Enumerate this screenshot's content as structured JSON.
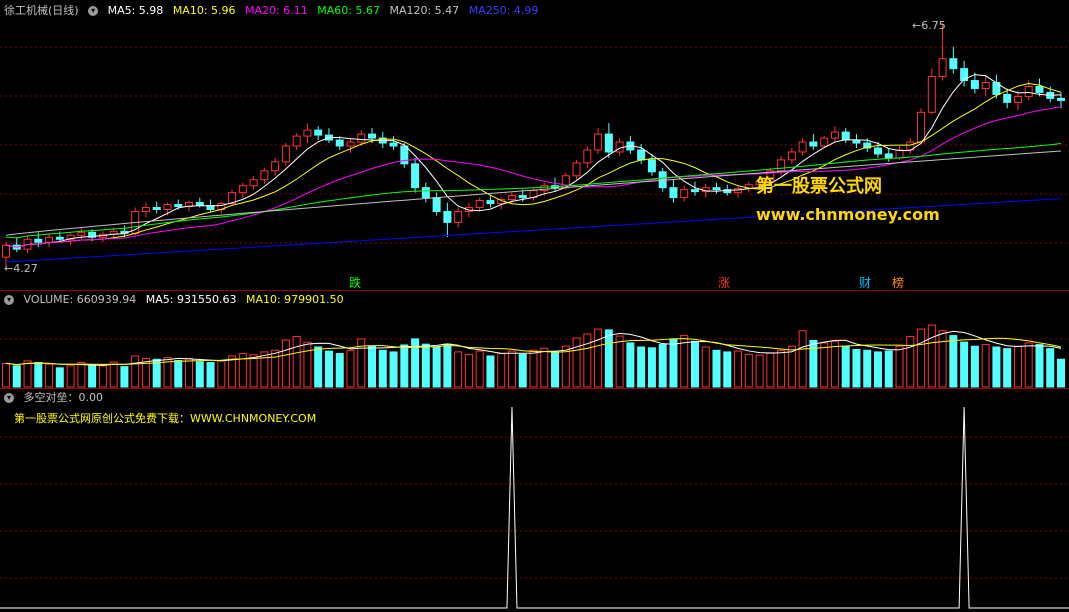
{
  "price_header": {
    "title": "徐工机械(日线)",
    "ma5": "MA5: 5.98",
    "ma10": "MA10: 5.96",
    "ma20": "MA20: 6.11",
    "ma60": "MA60: 5.67",
    "ma120": "MA120: 5.47",
    "ma250": "MA250: 4.99"
  },
  "price_marks": {
    "high": "6.75",
    "low": "4.27"
  },
  "event_tags": [
    {
      "text": "跌",
      "color": "#00ff00"
    },
    {
      "text": "涨",
      "color": "#ff3030"
    },
    {
      "text": "财",
      "color": "#00bfff"
    },
    {
      "text": "榜",
      "color": "#ff8c00"
    }
  ],
  "watermark": {
    "line1": "第一股票公式网",
    "line2": "www.chnmoney.com"
  },
  "volume_header": {
    "volume": "VOLUME: 660939.94",
    "ma5": "MA5: 931550.63",
    "ma10": "MA10: 979901.50"
  },
  "indicator_header": {
    "name": "多空对垒：0.00",
    "note": "第一股票公式网原创公式免费下载：WWW.CHNMONEY.COM"
  },
  "colors": {
    "up": "#ff3030",
    "down": "#54ffff",
    "ma5": "#ffffff",
    "ma10": "#ffff00",
    "ma20": "#ff00ff",
    "ma60": "#00ff00",
    "ma120": "#c0c0c0",
    "ma250": "#0000ff",
    "grid": "#8b0000"
  },
  "chart_data": {
    "type": "candlestick",
    "ylim": [
      4.27,
      6.75
    ],
    "candles": [
      [
        4.4,
        4.55,
        4.3,
        4.52
      ],
      [
        4.52,
        4.6,
        4.45,
        4.48
      ],
      [
        4.48,
        4.62,
        4.44,
        4.58
      ],
      [
        4.58,
        4.65,
        4.5,
        4.55
      ],
      [
        4.55,
        4.63,
        4.5,
        4.6
      ],
      [
        4.6,
        4.66,
        4.55,
        4.58
      ],
      [
        4.58,
        4.64,
        4.52,
        4.62
      ],
      [
        4.62,
        4.7,
        4.58,
        4.65
      ],
      [
        4.65,
        4.68,
        4.56,
        4.6
      ],
      [
        4.6,
        4.66,
        4.55,
        4.63
      ],
      [
        4.63,
        4.7,
        4.58,
        4.66
      ],
      [
        4.66,
        4.72,
        4.6,
        4.64
      ],
      [
        4.64,
        4.9,
        4.62,
        4.86
      ],
      [
        4.86,
        4.95,
        4.8,
        4.9
      ],
      [
        4.9,
        4.96,
        4.84,
        4.88
      ],
      [
        4.88,
        4.95,
        4.82,
        4.93
      ],
      [
        4.93,
        4.98,
        4.88,
        4.91
      ],
      [
        4.91,
        4.97,
        4.86,
        4.95
      ],
      [
        4.95,
        5.0,
        4.9,
        4.92
      ],
      [
        4.92,
        4.98,
        4.85,
        4.88
      ],
      [
        4.88,
        4.96,
        4.84,
        4.94
      ],
      [
        4.94,
        5.08,
        4.92,
        5.05
      ],
      [
        5.05,
        5.15,
        5.0,
        5.12
      ],
      [
        5.12,
        5.22,
        5.08,
        5.18
      ],
      [
        5.18,
        5.3,
        5.14,
        5.27
      ],
      [
        5.27,
        5.4,
        5.22,
        5.36
      ],
      [
        5.36,
        5.55,
        5.32,
        5.52
      ],
      [
        5.52,
        5.65,
        5.48,
        5.62
      ],
      [
        5.62,
        5.75,
        5.55,
        5.68
      ],
      [
        5.68,
        5.72,
        5.58,
        5.63
      ],
      [
        5.63,
        5.7,
        5.55,
        5.58
      ],
      [
        5.58,
        5.62,
        5.48,
        5.52
      ],
      [
        5.52,
        5.6,
        5.45,
        5.56
      ],
      [
        5.56,
        5.68,
        5.52,
        5.64
      ],
      [
        5.64,
        5.7,
        5.55,
        5.6
      ],
      [
        5.6,
        5.66,
        5.5,
        5.55
      ],
      [
        5.55,
        5.62,
        5.48,
        5.52
      ],
      [
        5.52,
        5.55,
        5.3,
        5.34
      ],
      [
        5.34,
        5.4,
        5.05,
        5.1
      ],
      [
        5.1,
        5.15,
        4.95,
        5.0
      ],
      [
        5.0,
        5.05,
        4.82,
        4.86
      ],
      [
        4.86,
        4.95,
        4.6,
        4.75
      ],
      [
        4.75,
        4.9,
        4.7,
        4.86
      ],
      [
        4.86,
        4.95,
        4.8,
        4.9
      ],
      [
        4.9,
        5.0,
        4.86,
        4.97
      ],
      [
        4.97,
        5.02,
        4.9,
        4.94
      ],
      [
        4.94,
        5.0,
        4.88,
        4.98
      ],
      [
        4.98,
        5.05,
        4.94,
        5.02
      ],
      [
        5.02,
        5.08,
        4.96,
        5.0
      ],
      [
        5.0,
        5.1,
        4.97,
        5.07
      ],
      [
        5.07,
        5.15,
        5.02,
        5.12
      ],
      [
        5.12,
        5.2,
        5.06,
        5.1
      ],
      [
        5.1,
        5.25,
        5.08,
        5.22
      ],
      [
        5.22,
        5.38,
        5.18,
        5.35
      ],
      [
        5.35,
        5.52,
        5.3,
        5.48
      ],
      [
        5.48,
        5.7,
        5.44,
        5.64
      ],
      [
        5.64,
        5.75,
        5.4,
        5.46
      ],
      [
        5.46,
        5.6,
        5.42,
        5.56
      ],
      [
        5.56,
        5.62,
        5.44,
        5.48
      ],
      [
        5.48,
        5.54,
        5.34,
        5.38
      ],
      [
        5.38,
        5.44,
        5.22,
        5.26
      ],
      [
        5.26,
        5.3,
        5.06,
        5.1
      ],
      [
        5.1,
        5.18,
        4.95,
        5.0
      ],
      [
        5.0,
        5.12,
        4.96,
        5.08
      ],
      [
        5.08,
        5.16,
        5.02,
        5.06
      ],
      [
        5.06,
        5.14,
        5.0,
        5.1
      ],
      [
        5.1,
        5.15,
        5.04,
        5.08
      ],
      [
        5.08,
        5.13,
        5.02,
        5.05
      ],
      [
        5.05,
        5.12,
        5.0,
        5.09
      ],
      [
        5.09,
        5.16,
        5.05,
        5.13
      ],
      [
        5.13,
        5.2,
        5.08,
        5.16
      ],
      [
        5.16,
        5.3,
        5.12,
        5.27
      ],
      [
        5.27,
        5.42,
        5.22,
        5.38
      ],
      [
        5.38,
        5.5,
        5.34,
        5.46
      ],
      [
        5.46,
        5.6,
        5.42,
        5.56
      ],
      [
        5.56,
        5.64,
        5.48,
        5.52
      ],
      [
        5.52,
        5.62,
        5.5,
        5.6
      ],
      [
        5.6,
        5.72,
        5.55,
        5.66
      ],
      [
        5.66,
        5.7,
        5.55,
        5.58
      ],
      [
        5.58,
        5.64,
        5.5,
        5.55
      ],
      [
        5.55,
        5.6,
        5.46,
        5.5
      ],
      [
        5.5,
        5.56,
        5.4,
        5.44
      ],
      [
        5.44,
        5.5,
        5.36,
        5.4
      ],
      [
        5.4,
        5.52,
        5.38,
        5.48
      ],
      [
        5.48,
        5.6,
        5.44,
        5.56
      ],
      [
        5.56,
        5.9,
        5.54,
        5.86
      ],
      [
        5.86,
        6.3,
        5.84,
        6.22
      ],
      [
        6.22,
        6.75,
        6.18,
        6.4
      ],
      [
        6.4,
        6.52,
        6.25,
        6.3
      ],
      [
        6.3,
        6.38,
        6.12,
        6.18
      ],
      [
        6.18,
        6.26,
        6.05,
        6.1
      ],
      [
        6.1,
        6.22,
        6.02,
        6.16
      ],
      [
        6.16,
        6.24,
        6.0,
        6.04
      ],
      [
        6.04,
        6.1,
        5.9,
        5.96
      ],
      [
        5.96,
        6.08,
        5.88,
        6.02
      ],
      [
        6.02,
        6.18,
        5.98,
        6.12
      ],
      [
        6.12,
        6.2,
        6.02,
        6.06
      ],
      [
        6.06,
        6.12,
        5.96,
        6.0
      ],
      [
        6.0,
        6.06,
        5.9,
        5.98
      ]
    ],
    "volume": [
      580,
      520,
      640,
      600,
      560,
      470,
      520,
      600,
      540,
      520,
      610,
      500,
      760,
      700,
      680,
      720,
      650,
      700,
      620,
      600,
      640,
      760,
      820,
      790,
      860,
      900,
      1150,
      1240,
      1100,
      980,
      880,
      820,
      900,
      1180,
      1000,
      900,
      860,
      1030,
      1180,
      1050,
      980,
      1050,
      860,
      800,
      880,
      760,
      820,
      880,
      800,
      900,
      950,
      860,
      1000,
      1200,
      1300,
      1420,
      1400,
      1250,
      1080,
      980,
      960,
      1040,
      1180,
      1260,
      1120,
      980,
      900,
      860,
      880,
      800,
      780,
      840,
      900,
      1000,
      1380,
      1140,
      1080,
      1120,
      1000,
      920,
      900,
      860,
      880,
      1000,
      1240,
      1420,
      1520,
      1380,
      1260,
      1100,
      1000,
      1040,
      980,
      940,
      1000,
      1080,
      1040,
      940,
      680
    ],
    "signal_peaks": [
      47,
      89
    ],
    "indicator_value": 0.0
  }
}
